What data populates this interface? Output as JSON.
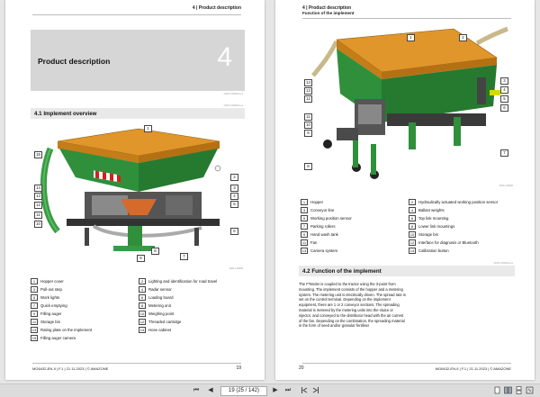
{
  "left_page": {
    "header": "4 | Product description",
    "chapter_title": "Product description",
    "chapter_number": "4",
    "chapter_code": "CMS-T-00000-A-A",
    "section_code": "CMS-T-00000-A-A",
    "section_title": "4.1  Implement overview",
    "figure_code": "CMS-I-00000",
    "callouts": [
      "1",
      "2",
      "3",
      "4",
      "5",
      "6",
      "7",
      "8",
      "9",
      "10",
      "11",
      "12",
      "13",
      "14",
      "15"
    ],
    "legend": [
      {
        "n": "1",
        "t": "Hopper cover"
      },
      {
        "n": "2",
        "t": "Lighting and identification for road travel"
      },
      {
        "n": "3",
        "t": "Pull-out step"
      },
      {
        "n": "4",
        "t": "Radar sensor"
      },
      {
        "n": "5",
        "t": "Work lights"
      },
      {
        "n": "6",
        "t": "Loading board"
      },
      {
        "n": "7",
        "t": "Quick emptying"
      },
      {
        "n": "8",
        "t": "Metering unit"
      },
      {
        "n": "9",
        "t": "Filling auger"
      },
      {
        "n": "10",
        "t": "Weighing point"
      },
      {
        "n": "11",
        "t": "Storage bin"
      },
      {
        "n": "12",
        "t": "Threaded cartridge"
      },
      {
        "n": "13",
        "t": "Rating plate on the implement"
      },
      {
        "n": "14",
        "t": "Hose cabinet"
      },
      {
        "n": "15",
        "t": "Filling auger camera"
      }
    ],
    "footer_left": "MG6432-EN-II | F.1 | 21.11.2023 | © AMAZONE",
    "page_number": "19"
  },
  "right_page": {
    "header": "4 | Product description",
    "subheader": "Function of the implement",
    "figure_code": "CMS-I-00000",
    "callouts": [
      "1",
      "2",
      "3",
      "4",
      "5",
      "6",
      "7",
      "8",
      "9",
      "10",
      "11",
      "12",
      "13",
      "14"
    ],
    "legend": [
      {
        "n": "1",
        "t": "Hopper"
      },
      {
        "n": "2",
        "t": "Hydraulically actuated working position sensor"
      },
      {
        "n": "3",
        "t": "Conveyor line"
      },
      {
        "n": "4",
        "t": "Ballast weights"
      },
      {
        "n": "5",
        "t": "Working position sensor"
      },
      {
        "n": "6",
        "t": "Top link mounting"
      },
      {
        "n": "7",
        "t": "Parking rollers"
      },
      {
        "n": "8",
        "t": "Lower link mountings"
      },
      {
        "n": "9",
        "t": "Hand wash tank"
      },
      {
        "n": "10",
        "t": "Storage bin"
      },
      {
        "n": "11",
        "t": "Fan"
      },
      {
        "n": "12",
        "t": "Interface for diagnosis or Bluetooth"
      },
      {
        "n": "13",
        "t": "Camera system"
      },
      {
        "n": "14",
        "t": "Calibration button"
      }
    ],
    "section_title": "4.2  Function of the implement",
    "section_code": "CMS-T-00000-A-A",
    "body_text": "The FTender is coupled to the tractor using the 3-point from mounting. The implement consists of the hopper and a metering system. The metering unit is electrically driven. The spread rate is set on the control terminal. Depending on the implement equipment, there are 1 or 2 conveyor sections. The spreading material is metered by the metering units into the sluice or injector, and conveyed to the distributor head with the air current of the fan. Depending on the combination, the spreading material in the form of seed and/or granular fertiliser",
    "footer_left": "MG6432-EN-II | F.1 | 21.11.2023 | © AMAZONE",
    "page_number": "20"
  },
  "toolbar": {
    "first_label": "⏮",
    "prev_label": "◀",
    "page_value": "19 (25 / 142)",
    "next_label": "▶",
    "last_label": "⏭"
  }
}
